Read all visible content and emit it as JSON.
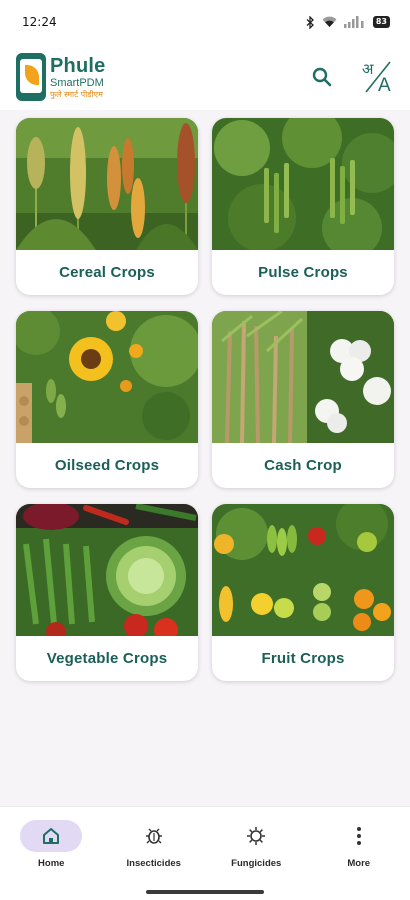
{
  "status_bar": {
    "time": "12:24",
    "battery": "83",
    "icons": [
      "bluetooth-icon",
      "wifi-icon",
      "signal-icon",
      "battery-icon"
    ]
  },
  "header": {
    "app_name": "Phule",
    "app_subtitle": "SmartPDM",
    "app_devnagari": "फुले स्मार्ट पीडीएम",
    "search_icon": "search-icon",
    "language_icon": "translate-icon"
  },
  "crops": [
    {
      "label": "Cereal Crops",
      "theme": "cereal"
    },
    {
      "label": "Pulse Crops",
      "theme": "pulse"
    },
    {
      "label": "Oilseed Crops",
      "theme": "oilseed"
    },
    {
      "label": "Cash Crop",
      "theme": "cash"
    },
    {
      "label": "Vegetable Crops",
      "theme": "vegetable"
    },
    {
      "label": "Fruit Crops",
      "theme": "fruit"
    }
  ],
  "bottom_nav": [
    {
      "label": "Home",
      "icon": "home-icon",
      "active": true
    },
    {
      "label": "Insecticides",
      "icon": "bug-icon",
      "active": false
    },
    {
      "label": "Fungicides",
      "icon": "virus-icon",
      "active": false
    },
    {
      "label": "More",
      "icon": "more-vertical-icon",
      "active": false
    }
  ],
  "colors": {
    "brand": "#1f6e63",
    "accent": "#f2a21b",
    "label_text": "#1a5f58",
    "nav_active": "#e2d9f4",
    "background": "#f6f4f7"
  }
}
